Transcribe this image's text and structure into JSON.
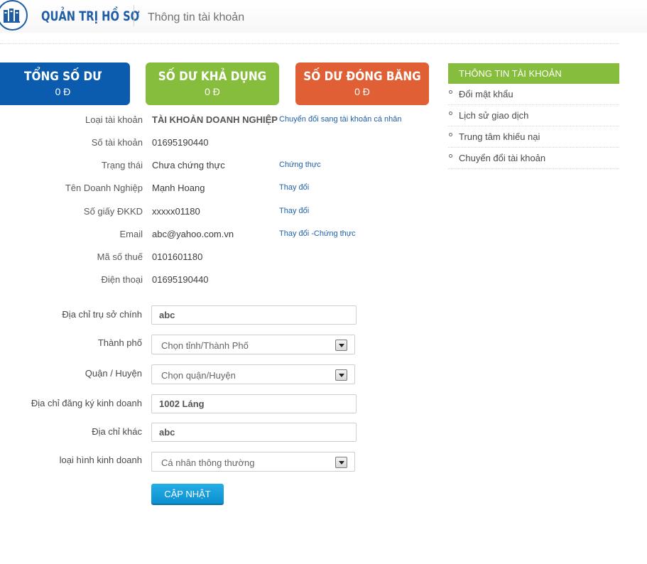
{
  "header": {
    "brand": "QUẢN TRỊ HỒ SƠ",
    "title": "Thông tin tài khoản",
    "logo_icon": "books-icon"
  },
  "balances": [
    {
      "label": "TỔNG SỐ DƯ",
      "value": "0 Đ",
      "color": "#0b5cae"
    },
    {
      "label": "SỐ DƯ KHẢ DỤNG",
      "value": "0 Đ",
      "color": "#86bd3c"
    },
    {
      "label": "SỐ DƯ ĐÓNG BĂNG",
      "value": "0 Đ",
      "color": "#e05f34"
    }
  ],
  "account_info": {
    "account_type": {
      "label": "Loại tài khoản",
      "value": "TÀI KHOẢN DOANH NGHIỆP",
      "link": "Chuyển đổi sang tài khoản cá nhân"
    },
    "account_number": {
      "label": "Số tài khoản",
      "value": "01695190440"
    },
    "status": {
      "label": "Trạng thái",
      "value": "Chưa chứng thực",
      "link": "Chứng thực"
    },
    "company_name": {
      "label": "Tên Doanh Nghiệp",
      "value": "Mạnh Hoang",
      "link": "Thay đổi"
    },
    "business_license": {
      "label": "Số giấy ĐKKD",
      "value": "xxxxx01180",
      "link": "Thay đổi"
    },
    "email": {
      "label": "Email",
      "value": "abc@yahoo.com.vn",
      "link": "Thay đổi -Chứng thực"
    },
    "tax_code": {
      "label": "Mã số thuế",
      "value": "0101601180"
    },
    "phone": {
      "label": "Điện thoại",
      "value": "01695190440"
    }
  },
  "form": {
    "head_office_address": {
      "label": "Địa chỉ trụ sở chính",
      "value": "abc"
    },
    "city": {
      "label": "Thành phố",
      "selected": "Chọn tỉnh/Thành Phố"
    },
    "district": {
      "label": "Quận / Huyện",
      "selected": "Chọn quận/Huyện"
    },
    "registered_address": {
      "label": "Địa chỉ đăng ký kinh doanh",
      "value": "1002 Láng"
    },
    "other_address": {
      "label": "Địa chỉ khác",
      "value": "abc"
    },
    "business_type": {
      "label": "loại hình kinh doanh",
      "selected": "Cá nhân thông thường"
    },
    "submit_label": "CẬP NHẬT"
  },
  "sidebar": {
    "title": "THÔNG TIN TÀI KHOẢN",
    "items": [
      {
        "label": "Đổi mật khẩu"
      },
      {
        "label": "Lịch sử giao dịch"
      },
      {
        "label": "Trung tâm khiếu nại"
      },
      {
        "label": "Chuyển đổi tài khoản"
      }
    ]
  }
}
